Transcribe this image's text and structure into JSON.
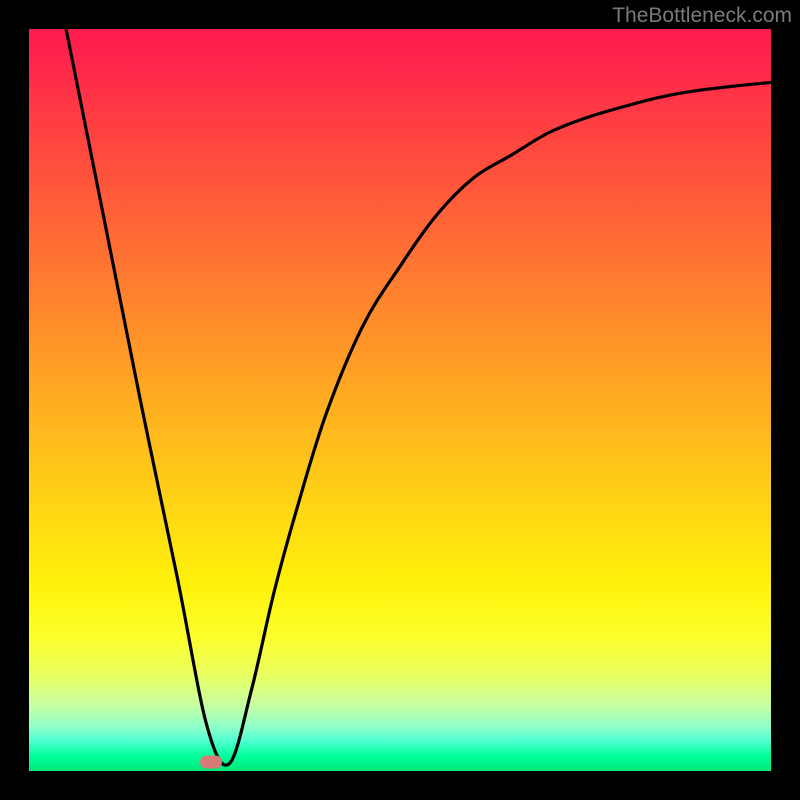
{
  "watermark": "TheBottleneck.com",
  "chart_data": {
    "type": "line",
    "title": "",
    "xlabel": "",
    "ylabel": "",
    "xlim": [
      0,
      100
    ],
    "ylim": [
      0,
      100
    ],
    "grid": false,
    "series": [
      {
        "name": "curve",
        "x": [
          5,
          10,
          15,
          20,
          24,
          27,
          30,
          33,
          36,
          40,
          45,
          50,
          55,
          60,
          65,
          70,
          75,
          80,
          85,
          90,
          95,
          100
        ],
        "y": [
          100,
          75,
          50,
          26,
          6,
          1,
          11,
          24,
          35,
          48,
          60,
          68,
          75,
          80,
          83,
          86,
          88,
          89.5,
          90.8,
          91.7,
          92.3,
          92.8
        ]
      }
    ],
    "marker": {
      "x": 24.5,
      "y": 1.2,
      "color": "#d77b78"
    },
    "background_gradient": {
      "stops": [
        {
          "pos": 0.0,
          "color": "#ff1a4f"
        },
        {
          "pos": 0.5,
          "color": "#ffb21f"
        },
        {
          "pos": 0.8,
          "color": "#fcff2c"
        },
        {
          "pos": 1.0,
          "color": "#00e87a"
        }
      ]
    }
  }
}
